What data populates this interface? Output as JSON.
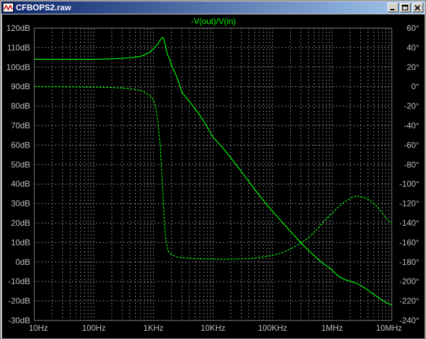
{
  "window": {
    "title": "CFBOPS2.raw",
    "minimize_label": "_",
    "maximize_label": "□",
    "close_label": "×"
  },
  "colors": {
    "background": "#000000",
    "grid": "#808080",
    "axis_text": "#c0c0c0",
    "trace": "#00ff00"
  },
  "chart_data": {
    "type": "line",
    "title": "-V(out)/V(in)",
    "xscale": "log",
    "xlim": [
      10,
      10000000
    ],
    "ylim_left": [
      -30,
      120
    ],
    "ylim_right": [
      -240,
      60
    ],
    "x_ticks": [
      {
        "value": 10,
        "label": "10Hz"
      },
      {
        "value": 100,
        "label": "100Hz"
      },
      {
        "value": 1000,
        "label": "1KHz"
      },
      {
        "value": 10000,
        "label": "10KHz"
      },
      {
        "value": 100000,
        "label": "100KHz"
      },
      {
        "value": 1000000,
        "label": "1MHz"
      },
      {
        "value": 10000000,
        "label": "10MHz"
      }
    ],
    "y_ticks_left": [
      {
        "value": 120,
        "label": "120dB"
      },
      {
        "value": 110,
        "label": "110dB"
      },
      {
        "value": 100,
        "label": "100dB"
      },
      {
        "value": 90,
        "label": "90dB"
      },
      {
        "value": 80,
        "label": "80dB"
      },
      {
        "value": 70,
        "label": "70dB"
      },
      {
        "value": 60,
        "label": "60dB"
      },
      {
        "value": 50,
        "label": "50dB"
      },
      {
        "value": 40,
        "label": "40dB"
      },
      {
        "value": 30,
        "label": "30dB"
      },
      {
        "value": 20,
        "label": "20dB"
      },
      {
        "value": 10,
        "label": "10dB"
      },
      {
        "value": 0,
        "label": "0dB"
      },
      {
        "value": -10,
        "label": "-10dB"
      },
      {
        "value": -20,
        "label": "-20dB"
      },
      {
        "value": -30,
        "label": "-30dB"
      }
    ],
    "y_ticks_right": [
      {
        "value": 60,
        "label": "60°"
      },
      {
        "value": 40,
        "label": "40°"
      },
      {
        "value": 20,
        "label": "20°"
      },
      {
        "value": 0,
        "label": "0°"
      },
      {
        "value": -20,
        "label": "-20°"
      },
      {
        "value": -40,
        "label": "-40°"
      },
      {
        "value": -60,
        "label": "-60°"
      },
      {
        "value": -80,
        "label": "-80°"
      },
      {
        "value": -100,
        "label": "-100°"
      },
      {
        "value": -120,
        "label": "-120°"
      },
      {
        "value": -140,
        "label": "-140°"
      },
      {
        "value": -160,
        "label": "-160°"
      },
      {
        "value": -180,
        "label": "-180°"
      },
      {
        "value": -200,
        "label": "-200°"
      },
      {
        "value": -220,
        "label": "-220°"
      },
      {
        "value": -240,
        "label": "-240°"
      }
    ],
    "grid": true,
    "series": [
      {
        "style": "solid",
        "axis": "left",
        "unit": "dB",
        "x": [
          10,
          100,
          300,
          600,
          900,
          1200,
          1400,
          1500,
          1700,
          2000,
          3000,
          10000,
          100000,
          1000000,
          3000000,
          10000000
        ],
        "y": [
          104,
          104,
          104.5,
          105.5,
          108,
          112,
          115,
          114,
          107,
          101,
          87,
          64,
          26,
          -4,
          -12,
          -22
        ]
      },
      {
        "style": "dashed",
        "axis": "right",
        "unit": "deg",
        "x": [
          10,
          100,
          300,
          600,
          900,
          1100,
          1300,
          1450,
          1550,
          1650,
          1800,
          2500,
          10000,
          50000,
          150000,
          400000,
          1000000,
          2000000,
          3000000,
          5000000,
          10000000
        ],
        "y": [
          0,
          -0.5,
          -1.5,
          -4,
          -10,
          -22,
          -60,
          -110,
          -145,
          -160,
          -170,
          -175,
          -177,
          -176,
          -170,
          -155,
          -130,
          -115,
          -113,
          -120,
          -140
        ]
      }
    ]
  }
}
